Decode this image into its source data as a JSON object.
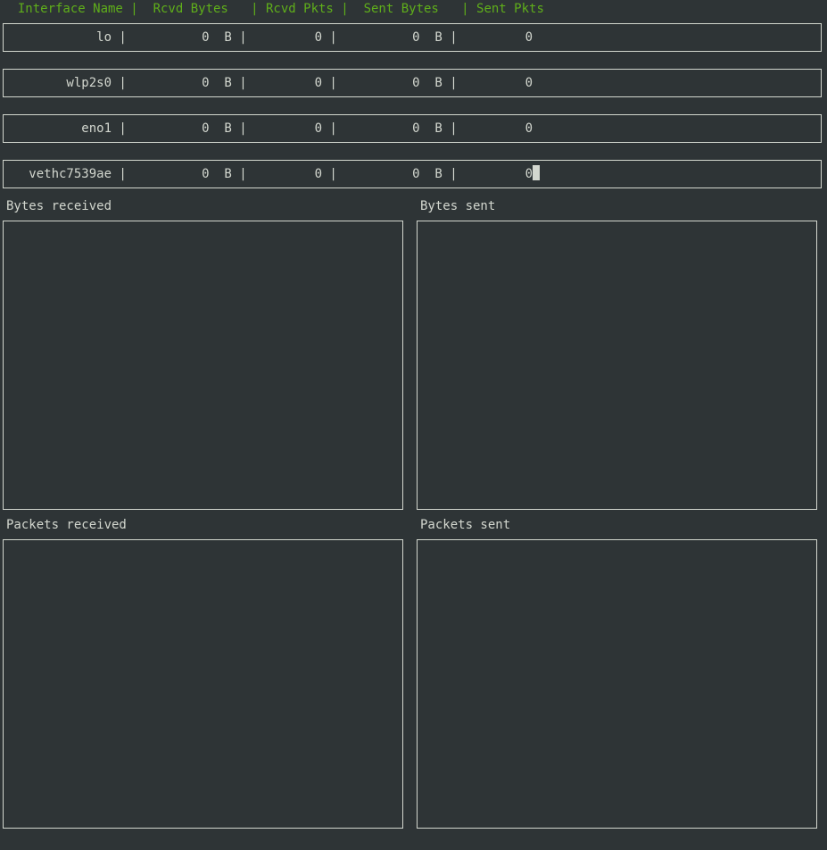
{
  "header": {
    "text": "  Interface Name |  Rcvd Bytes   | Rcvd Pkts |  Sent Bytes   | Sent Pkts"
  },
  "interfaces": [
    {
      "name": "lo",
      "rcvd_bytes": "0  B",
      "rcvd_pkts": "0",
      "sent_bytes": "0  B",
      "sent_pkts": "0"
    },
    {
      "name": "wlp2s0",
      "rcvd_bytes": "0  B",
      "rcvd_pkts": "0",
      "sent_bytes": "0  B",
      "sent_pkts": "0"
    },
    {
      "name": "eno1",
      "rcvd_bytes": "0  B",
      "rcvd_pkts": "0",
      "sent_bytes": "0  B",
      "sent_pkts": "0"
    },
    {
      "name": "vethc7539ae",
      "rcvd_bytes": "0  B",
      "rcvd_pkts": "0",
      "sent_bytes": "0  B",
      "sent_pkts": "0"
    }
  ],
  "rows_text": [
    "            lo |          0  B |         0 |          0  B |         0",
    "        wlp2s0 |          0  B |         0 |          0  B |         0",
    "          eno1 |          0  B |         0 |          0  B |         0",
    "   vethc7539ae |          0  B |         0 |          0  B |         0"
  ],
  "panels": {
    "bytes_received": {
      "title": "Bytes received"
    },
    "bytes_sent": {
      "title": "Bytes sent"
    },
    "packets_received": {
      "title": "Packets received"
    },
    "packets_sent": {
      "title": "Packets sent"
    }
  }
}
